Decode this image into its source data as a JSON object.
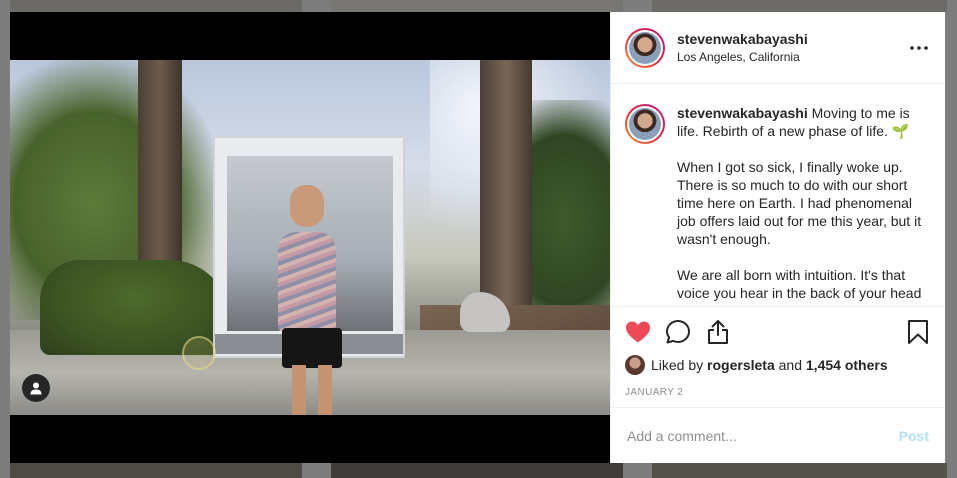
{
  "post": {
    "username": "stevenwakabayashi",
    "location": "Los Angeles, California",
    "caption_username": "stevenwakabayashi",
    "caption_paragraphs": [
      "Moving to me is life. Rebirth of a new phase of life. 🌱",
      "When I got so sick, I finally woke up. There is so much to do with our short time here on Earth. I had phenomenal job offers laid out for me this year, but it wasn't enough.",
      "We are all born with intuition. It's that voice you hear in the back of your head"
    ],
    "liked_by_prefix": "Liked by",
    "liked_by_user": "rogersleta",
    "liked_by_connector": "and",
    "liked_by_others": "1,454 others",
    "date": "JANUARY 2",
    "liked": true
  },
  "comment_box": {
    "placeholder": "Add a comment...",
    "post_label": "Post"
  },
  "icons": {
    "like": "heart-icon",
    "comment": "comment-bubble-icon",
    "share": "share-icon",
    "save": "bookmark-icon",
    "more": "more-options-icon",
    "tag": "user-tag-icon"
  },
  "colors": {
    "like": "#ed4956",
    "post_disabled": "#b2dffc",
    "muted_text": "#8e8e8e"
  }
}
